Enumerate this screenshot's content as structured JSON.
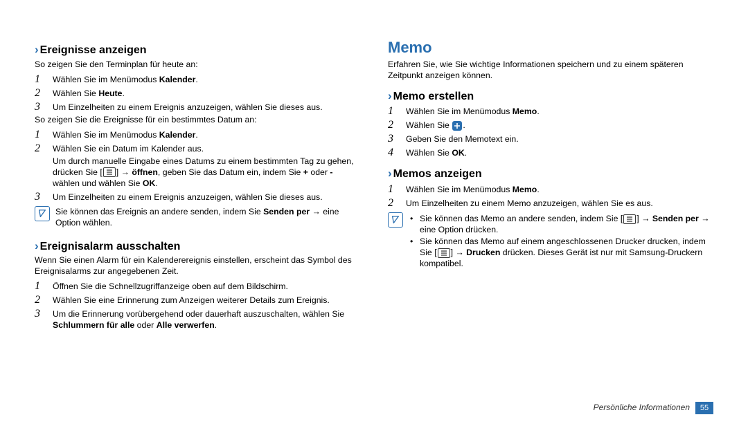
{
  "left": {
    "s1": {
      "title": "Ereignisse anzeigen",
      "intro1": "So zeigen Sie den Terminplan für heute an:",
      "st1a": "Wählen Sie im Menümodus ",
      "st1b": "Kalender",
      "st1c": ".",
      "st2a": "Wählen Sie ",
      "st2b": "Heute",
      "st2c": ".",
      "st3": "Um Einzelheiten zu einem Ereignis anzuzeigen, wählen Sie dieses aus.",
      "intro2": "So zeigen Sie die Ereignisse für ein bestimmtes Datum an:",
      "d1a": "Wählen Sie im Menümodus ",
      "d1b": "Kalender",
      "d1c": ".",
      "d2": "Wählen Sie ein Datum im Kalender aus.",
      "d2sub_a": "Um durch manuelle Eingabe eines Datums zu einem bestimmten Tag zu gehen, drücken Sie [",
      "d2sub_b": "] → ",
      "d2sub_c": "öffnen",
      "d2sub_d": ", geben Sie das Datum ein, indem Sie ",
      "d2sub_e": "+",
      "d2sub_f": " oder ",
      "d2sub_g": "-",
      "d2sub_h": " wählen und wählen Sie ",
      "d2sub_i": "OK",
      "d2sub_j": ".",
      "d3": "Um Einzelheiten zu einem Ereignis anzuzeigen, wählen Sie dieses aus.",
      "note_a": "Sie können das Ereignis an andere senden, indem Sie ",
      "note_b": "Senden per",
      "note_c": " → eine Option wählen."
    },
    "s2": {
      "title": "Ereignisalarm ausschalten",
      "intro": "Wenn Sie einen Alarm für ein Kalenderereignis einstellen, erscheint das Symbol des Ereignisalarms zur angegebenen Zeit.",
      "st1": "Öffnen Sie die Schnellzugriffanzeige oben auf dem Bildschirm.",
      "st2": "Wählen Sie eine Erinnerung zum Anzeigen weiterer Details zum Ereignis.",
      "st3a": "Um die Erinnerung vorübergehend oder dauerhaft auszuschalten, wählen Sie ",
      "st3b": "Schlummern für alle",
      "st3c": " oder ",
      "st3d": "Alle verwerfen",
      "st3e": "."
    }
  },
  "right": {
    "title": "Memo",
    "intro": "Erfahren Sie, wie Sie wichtige Informationen speichern und zu einem späteren Zeitpunkt anzeigen können.",
    "create": {
      "title": "Memo erstellen",
      "st1a": "Wählen Sie im Menümodus ",
      "st1b": "Memo",
      "st1c": ".",
      "st2": "Wählen Sie ",
      "st2b": ".",
      "st3": "Geben Sie den Memotext ein.",
      "st4a": "Wählen Sie ",
      "st4b": "OK",
      "st4c": "."
    },
    "view": {
      "title": "Memos anzeigen",
      "st1a": "Wählen Sie im Menümodus ",
      "st1b": "Memo",
      "st1c": ".",
      "st2": "Um Einzelheiten zu einem Memo anzuzeigen, wählen Sie es aus.",
      "b1a": "Sie können das Memo an andere senden, indem Sie [",
      "b1b": "] → ",
      "b1c": "Senden per",
      "b1d": " → eine Option drücken.",
      "b2a": "Sie können das Memo auf einem angeschlossenen Drucker drucken, indem Sie [",
      "b2b": "] → ",
      "b2c": "Drucken",
      "b2d": " drücken. Dieses Gerät ist nur mit Samsung-Druckern kompatibel."
    }
  },
  "footer": {
    "label": "Persönliche Informationen",
    "page": "55"
  },
  "digits": {
    "n1": "1",
    "n2": "2",
    "n3": "3",
    "n4": "4"
  }
}
